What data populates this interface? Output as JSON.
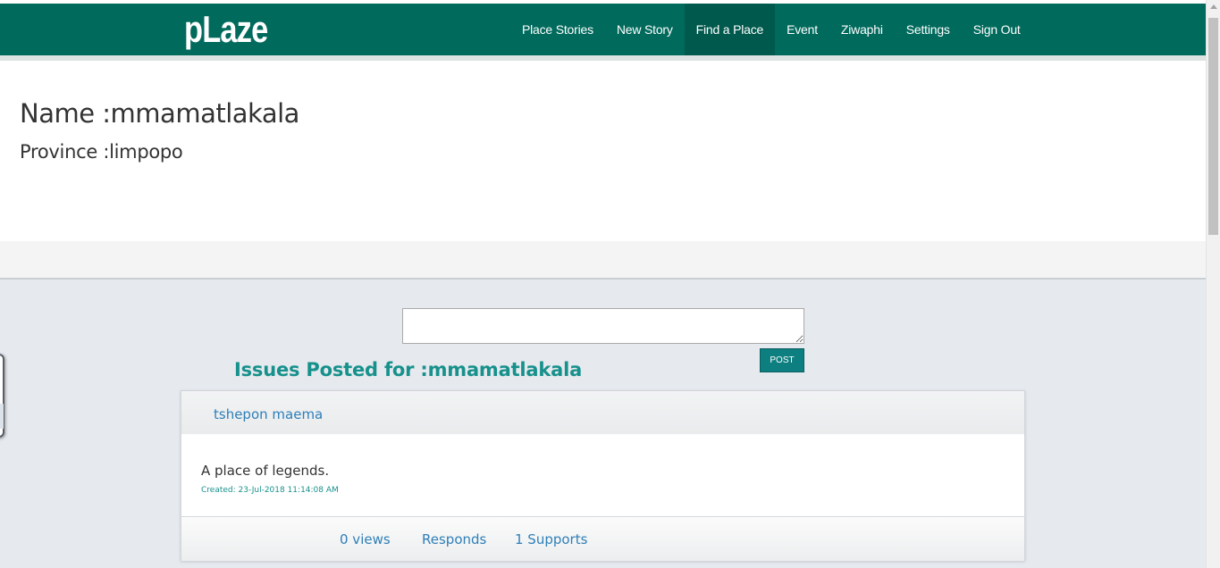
{
  "brand": "pLaze",
  "nav": [
    "Place Stories",
    "New Story",
    "Find a Place",
    "Event",
    "Ziwaphi",
    "Settings",
    "Sign Out"
  ],
  "nav_active": "Find a Place",
  "profile": {
    "name": "Name :mmamatlakala",
    "province": "Province :limpopo"
  },
  "composer": {
    "value": "",
    "post_label": "POST"
  },
  "issues_title": "Issues Posted for :mmamatlakala",
  "issue": {
    "author": "tshepon maema",
    "text": "A place of legends.",
    "created": "Created: 23-Jul-2018 11:14:08 AM",
    "views": "0 views",
    "responds": "Responds",
    "supports": "1 Supports"
  },
  "colors": {
    "navbar": "#006a5c",
    "accent": "#17918c",
    "link": "#2e7fb8"
  }
}
